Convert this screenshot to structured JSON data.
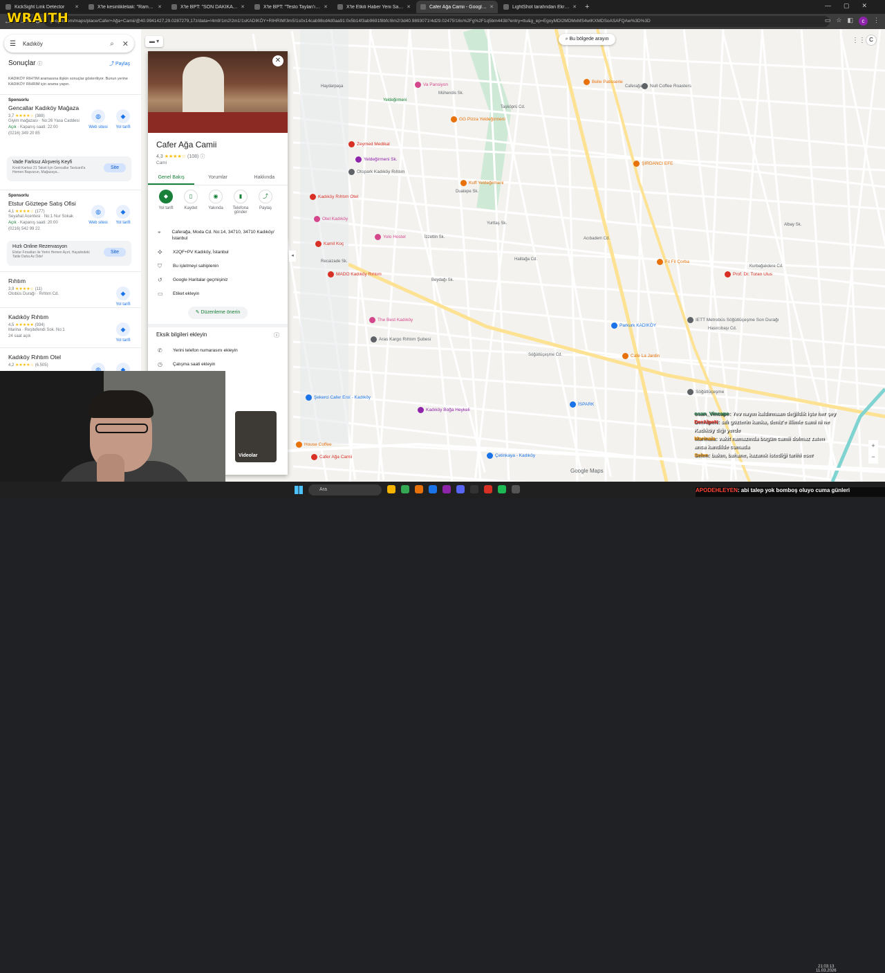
{
  "browser": {
    "tabs": [
      {
        "title": "KickSight Link Detector",
        "active": false
      },
      {
        "title": "X'te kesinlikleliak: \"Ramazan'da",
        "active": false
      },
      {
        "title": "X'te BPT: \"SON DAKİKA | İstanbul",
        "active": false
      },
      {
        "title": "X'te BPT: \"Testo Taylan'ın \"Sosyal",
        "active": false
      },
      {
        "title": "X'te Etkili Haber Yeni Sayfa: \"Ka",
        "active": false
      },
      {
        "title": "Cafer Ağa Camii - Google Haritalar",
        "active": true
      },
      {
        "title": "LightShot tarafından Ekran Görüntüsü",
        "active": false
      }
    ],
    "url": "google.com/maps/place/Cafer+Ağa+Camii/@40.9941427,29.0287279,17z/data=!4m9!1m2!2m1!1sKADIKÖY+RIHRIM!3m5!1s0x14cab98cd4d0aa91:0x5b14f3ab9691f8bfc!8m2!3d40.9893071!4d29.02475!16s%2Fg%2F1q5bm443b?entry=ttu&g_ep=EgoyMDI2MDMxMS4wIKXMDSoASAFQAw%3D%3D"
  },
  "overlay": {
    "brand": "WRAITH",
    "sub": "CAYS"
  },
  "sidebar": {
    "search_value": "Kadıköy",
    "results_title": "Sonuçlar",
    "share_label": "Paylaş",
    "note": "KADIKÖY RIHTIM aramasına ilişkin sonuçlar gösteriliyor. Bunun yerine KADIKÖY RIHRIM için arama yapın.",
    "results": [
      {
        "sponsor": "Sponsorlu",
        "name": "Gencallar Kadıköy Mağaza",
        "rating": "3,7",
        "stars": "★★★★☆",
        "count": "(388)",
        "line1": "Giyim mağazası · No:26 Yasa Caddesi",
        "line2_open": "Açık",
        "line2": " · Kapanış saati: 22:00",
        "line3": "(0216) 349 20 85",
        "a1": "Web sitesi",
        "a2": "Yol tarifi"
      },
      {
        "sponsor": "Sponsorlu",
        "name": "Etstur Göztepe Satış Ofisi",
        "rating": "4,1",
        "stars": "★★★★☆",
        "count": "(177)",
        "line1": "Seyahat Acentesi · No:1 Nur Sokak",
        "line2_open": "Açık",
        "line2": " · Kapanış saati: 20:00",
        "line3": "(0216) 542 99 22",
        "a1": "Web sitesi",
        "a2": "Yol tarifi"
      },
      {
        "sponsor": "",
        "name": "Rıhtım",
        "rating": "3,9",
        "stars": "★★★★☆",
        "count": "(11)",
        "line1": "Otobüs Durağı · Rıhtım Cd.",
        "line2_open": "",
        "line2": "",
        "line3": "",
        "a1": "",
        "a2": "Yol tarifi"
      },
      {
        "sponsor": "",
        "name": "Kadıköy Rıhtım",
        "rating": "4,5",
        "stars": "★★★★★",
        "count": "(934)",
        "line1": "Marina · Reşitefendi Sok. No:1",
        "line2_open": "",
        "line2": "24 saat açık",
        "line3": "",
        "a1": "",
        "a2": "Yol tarifi"
      },
      {
        "sponsor": "",
        "name": "Kadıköy Rıhtım Otel",
        "rating": "4,2",
        "stars": "★★★★☆",
        "count": "(6.505)",
        "line1": "",
        "line2_open": "",
        "line2": "",
        "line3": "",
        "a1": "Web sitesi",
        "a2": "Yol tarifi"
      }
    ],
    "promos": [
      {
        "title": "Vade Farksız Alışveriş Keyfi",
        "desc": "Kredi Kartsız 21 Taksit İçin Gencallar Taxicard'a Hemen Başvurun, Mağazaya...",
        "button": "Site"
      },
      {
        "title": "Hızlı Online Rezervasyon",
        "desc": "Etstur Fırsatları ile Yerini Hemen Ayırt, Hayalindeki Tatile Daha Az Öde!",
        "button": "Site"
      }
    ]
  },
  "place": {
    "title": "Cafer Ağa Camii",
    "rating": "4,3",
    "stars": "★★★★☆",
    "count": "(108)",
    "category": "Cami",
    "tabs": [
      "Genel Bakış",
      "Yorumlar",
      "Hakkında"
    ],
    "actions": [
      "Yol tarifi",
      "Kaydet",
      "Yakında",
      "Telefona gönder",
      "Paylaş"
    ],
    "address": "Caferağa, Moda Cd. No:14, 34710, 34710 Kadıköy/İstanbul",
    "plus_code": "X2QF+PV Kadıköy, İstanbul",
    "claim": "Bu işletmeyi sahiplenin",
    "history": "Google Haritalar geçmişiniz",
    "label": "Etiket ekleyin",
    "suggest": "Düzenleme önerin",
    "missing_title": "Eksik bilgileri ekleyin",
    "missing": [
      "Yerini telefon numarasını ekleyin",
      "Çalışma saati ekleyin"
    ],
    "video_label": "Videolar"
  },
  "map": {
    "search_area": "Bu bölgede arayın",
    "google_maps": "Google Maps",
    "streets": [
      {
        "t": "Yeldeğirmeni",
        "cls": "g"
      },
      {
        "t": "Mühendis Sk.",
        "cls": ""
      },
      {
        "t": "Taşköprü Cd.",
        "cls": ""
      },
      {
        "t": "Duatepe Sk.",
        "cls": ""
      },
      {
        "t": "Halitağa Cd.",
        "cls": ""
      },
      {
        "t": "Beydağı Sk.",
        "cls": ""
      },
      {
        "t": "Recaizade Sk.",
        "cls": ""
      },
      {
        "t": "Söğütlüçeşme Cd.",
        "cls": ""
      },
      {
        "t": "Caferağa",
        "cls": ""
      },
      {
        "t": "İzzettin Sk.",
        "cls": ""
      },
      {
        "t": "Yurttaş Sk.",
        "cls": ""
      },
      {
        "t": "Acıbadem Cd.",
        "cls": ""
      },
      {
        "t": "Kurbağalıdere Cd.",
        "cls": ""
      },
      {
        "t": "Albay Sk.",
        "cls": ""
      },
      {
        "t": "Haydarpaşa",
        "cls": ""
      },
      {
        "t": "Hasırcıbaşı Cd.",
        "cls": ""
      }
    ],
    "pois": [
      {
        "t": "Va Pansiyon",
        "c": "#d5478d"
      },
      {
        "t": "GG Pizza Yeldeğirmeni",
        "c": "#e8710a"
      },
      {
        "t": "Kuff Yeldeğirmeni",
        "c": "#e8710a"
      },
      {
        "t": "Zeymed Medikal",
        "c": "#d93025"
      },
      {
        "t": "Yeldeğirmeni Sk.",
        "c": "#8e24aa"
      },
      {
        "t": "Otopark Kadıköy Rıhtım",
        "c": "#5f6368"
      },
      {
        "t": "Kadıköy Rıhtım Otel",
        "c": "#d93025"
      },
      {
        "t": "Otel Kadıköy",
        "c": "#d5478d"
      },
      {
        "t": "Yolo Hostel",
        "c": "#d5478d"
      },
      {
        "t": "Kamil Koç",
        "c": "#d93025"
      },
      {
        "t": "MADO Kadıköy Rıhtım",
        "c": "#d93025"
      },
      {
        "t": "The Best Kadıköy",
        "c": "#d5478d"
      },
      {
        "t": "Aras Kargo Rıhtım Şubesi",
        "c": "#5f6368"
      },
      {
        "t": "Kadıköy Boğa Heykeli",
        "c": "#8e24aa"
      },
      {
        "t": "House Coffee",
        "c": "#e8710a"
      },
      {
        "t": "Şekerci Cafer Erol - Kadıköy",
        "c": "#1a73e8"
      },
      {
        "t": "Çetinkaya - Kadıköy",
        "c": "#1a73e8"
      },
      {
        "t": "Belle Patisserie",
        "c": "#e8710a"
      },
      {
        "t": "Null Coffee Roasters",
        "c": "#5f6368"
      },
      {
        "t": "ŞIRDANCI EFE",
        "c": "#e8710a"
      },
      {
        "t": "Fil Fil Çorba",
        "c": "#e8710a"
      },
      {
        "t": "Prof. Dr. Turan Ulus",
        "c": "#d93025"
      },
      {
        "t": "Parkurk KADIKÖY",
        "c": "#1a73e8"
      },
      {
        "t": "IETT Metrobüs Söğütlüçeşme Son Durağı",
        "c": "#5f6368"
      },
      {
        "t": "Cafe La Jardin",
        "c": "#e8710a"
      },
      {
        "t": "İSPARK",
        "c": "#1a73e8"
      },
      {
        "t": "Söğütlüçeşme",
        "c": "#5f6368"
      },
      {
        "t": "Cafer Ağa Camii",
        "c": "#d93025"
      }
    ]
  },
  "chat": [
    {
      "user": "osan_Vincape",
      "msg": ": Yev nayın kaldırmaan değildik işte her şey",
      "ucls": "u1"
    },
    {
      "user": "DerAlpeN",
      "msg": ": sıfı gözterin kanka, deniz'e illimle cami ni ne",
      "ucls": "u2"
    },
    {
      "user": "",
      "msg": "Kadıköy dığı yerde",
      "ucls": ""
    },
    {
      "user": "Marinaia",
      "msg": ": vakit namazında bugün camii dolmaz zaten",
      "ucls": "u3"
    },
    {
      "user": "",
      "msg": "anca kandilde cumada",
      "ucls": ""
    },
    {
      "user": "Selen",
      "msg": ": bakın, bahane, kazanık istediği tarihi eser",
      "ucls": "u3"
    }
  ],
  "ticker": {
    "user": "APODEHLEYEN",
    "msg": ": abi talep yok bomboş oluyo cuma günleri"
  },
  "taskbar": {
    "search": "Ara",
    "time": "21:03:13",
    "date": "11.03.2026"
  }
}
